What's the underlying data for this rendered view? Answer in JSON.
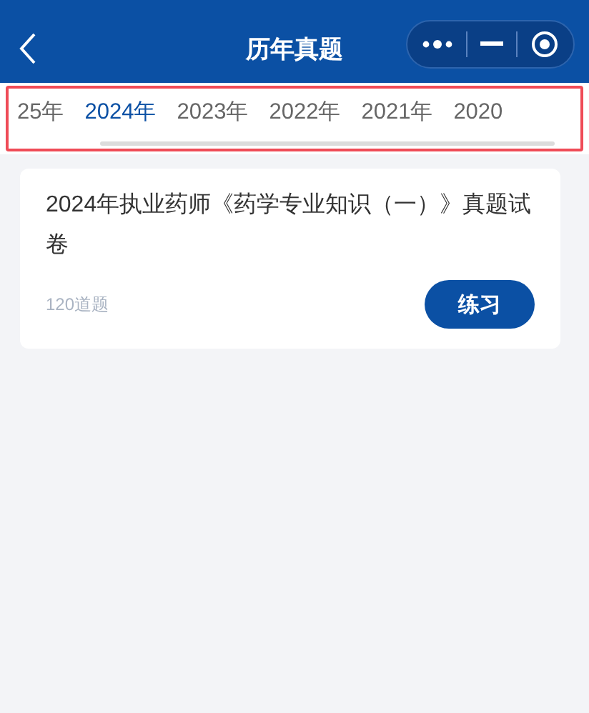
{
  "header": {
    "title": "历年真题"
  },
  "tabs": [
    {
      "label": "25年",
      "selected": false
    },
    {
      "label": "2024年",
      "selected": true
    },
    {
      "label": "2023年",
      "selected": false
    },
    {
      "label": "2022年",
      "selected": false
    },
    {
      "label": "2021年",
      "selected": false
    },
    {
      "label": "2020",
      "selected": false
    }
  ],
  "papers": [
    {
      "title": "2024年执业药师《药学专业知识（一）》真题试卷",
      "count": "120道题",
      "button": "练习"
    }
  ]
}
